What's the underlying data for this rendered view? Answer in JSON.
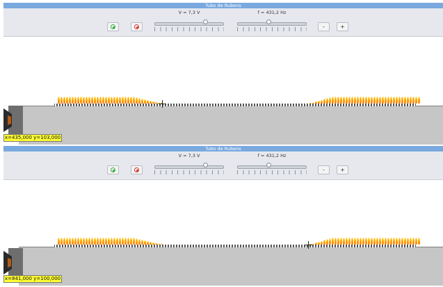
{
  "panels": [
    {
      "title": "Tubo de Rubens",
      "voltage_label": "V = 7,3 V",
      "frequency_label": "f = 431,2 Hz",
      "voltage_level": 0.7,
      "frequency_level": 0.45,
      "minus_label": "-",
      "plus_label": "+",
      "coordinates": "x=435,000 y=103,000",
      "flame_profile": {
        "left": {
          "from": 78,
          "to": 228,
          "fade_start": 188
        },
        "right": {
          "from": 440,
          "to": 598,
          "fade_end": 470
        }
      }
    },
    {
      "title": "Tubo de Rubens",
      "voltage_label": "V = 7,3 V",
      "frequency_label": "f = 431,2 Hz",
      "voltage_level": 0.7,
      "frequency_level": 0.45,
      "minus_label": "-",
      "plus_label": "+",
      "coordinates": "x=841,000 y=100,000",
      "flame_profile": {
        "left": {
          "from": 78,
          "to": 228,
          "fade_start": 188
        },
        "right": {
          "from": 440,
          "to": 598,
          "fade_end": 470
        }
      }
    }
  ]
}
